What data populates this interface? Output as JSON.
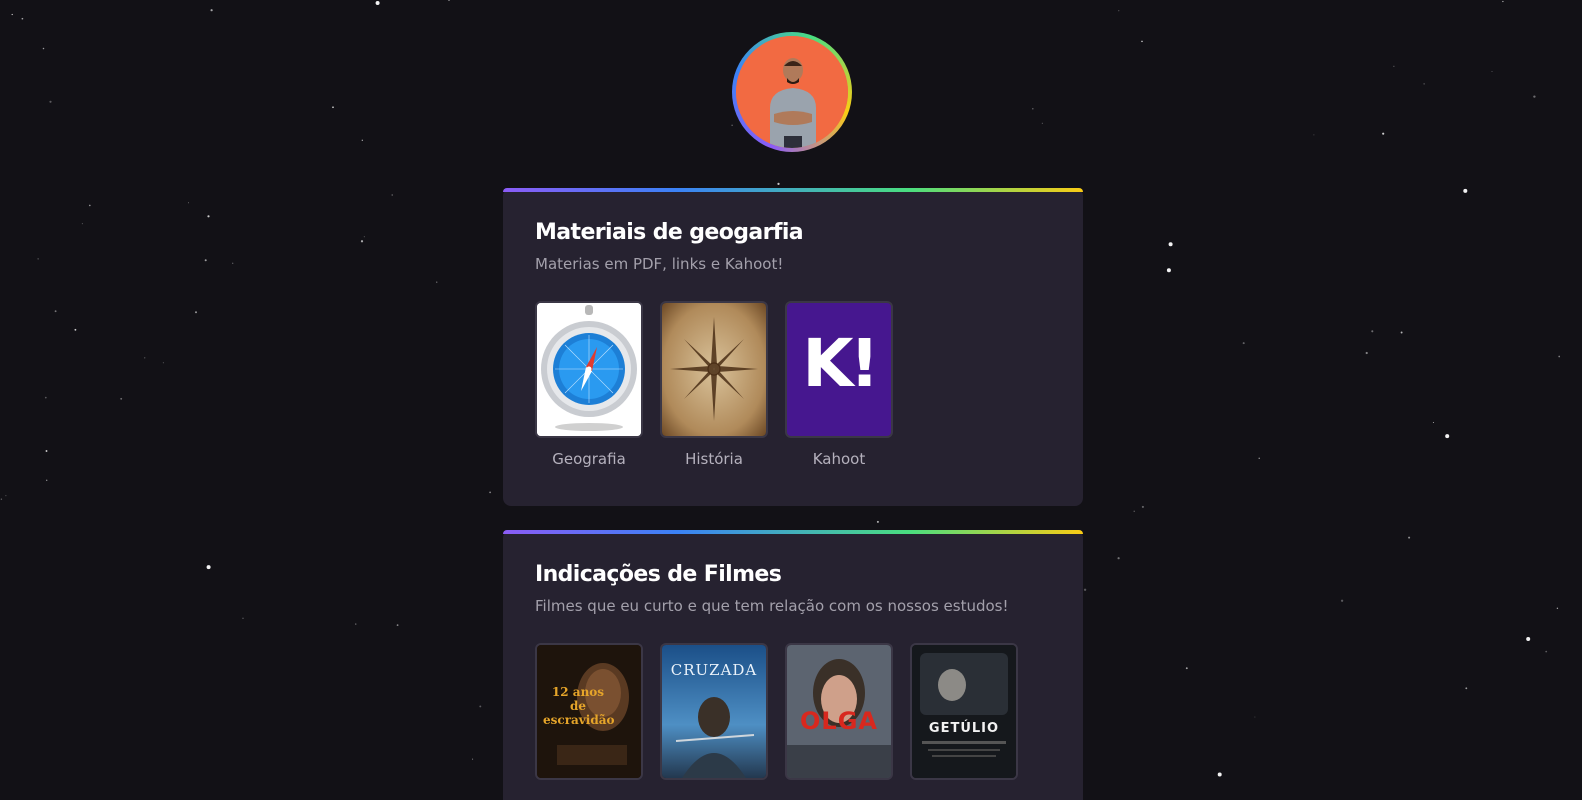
{
  "profile": {
    "avatar_alt": "avatar"
  },
  "sections": [
    {
      "title": "Materiais de geogarfia",
      "subtitle": "Materias em PDF, links e Kahoot!",
      "items": [
        {
          "label": "Geografia",
          "icon": "compass-icon"
        },
        {
          "label": "História",
          "icon": "compass-rose-map-icon"
        },
        {
          "label": "Kahoot",
          "icon": "kahoot-logo-icon",
          "logo_text": "K!"
        }
      ]
    },
    {
      "title": "Indicações de Filmes",
      "subtitle": "Filmes que eu curto e que tem relação com os nossos estudos!",
      "items": [
        {
          "poster_text": "12 anos de escravidão",
          "icon": "movie-poster-icon"
        },
        {
          "poster_text": "CRUZADA",
          "icon": "movie-poster-icon"
        },
        {
          "poster_text": "OLGA",
          "icon": "movie-poster-icon"
        },
        {
          "poster_text": "GETÚLIO",
          "icon": "movie-poster-icon"
        }
      ]
    }
  ],
  "colors": {
    "background": "#121116",
    "card": "#262230",
    "accent_gradient": [
      "#8b5cf6",
      "#3b82f6",
      "#4ade80",
      "#facc15"
    ],
    "avatar_bg": "#f26a42"
  }
}
